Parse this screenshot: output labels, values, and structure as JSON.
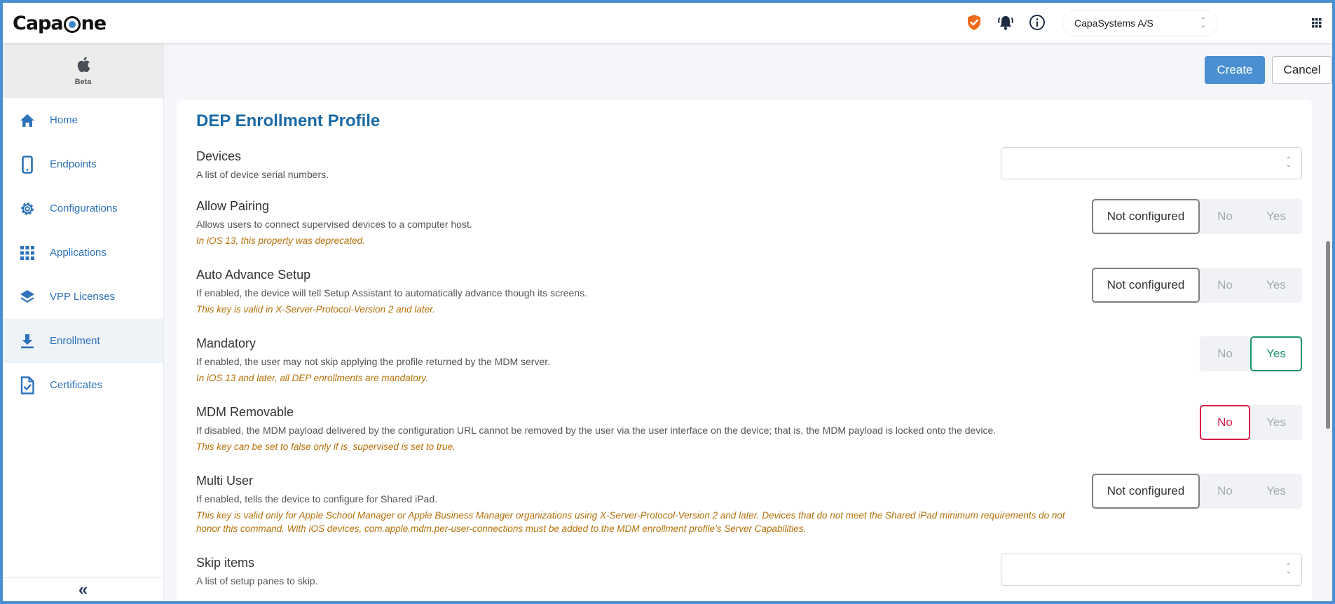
{
  "header": {
    "logo_text_left": "Capa",
    "logo_text_right": "ne",
    "org_selector": "CapaSystems A/S",
    "icons": [
      "shield-check-icon",
      "bell-icon",
      "info-icon",
      "apps-grid-icon"
    ],
    "colors": {
      "shield": "#f26a1b",
      "accent": "#4a8fd1"
    }
  },
  "sidebar": {
    "platform": {
      "icon": "apple-icon",
      "label": "Beta"
    },
    "items": [
      {
        "label": "Home",
        "icon": "home-icon",
        "active": false
      },
      {
        "label": "Endpoints",
        "icon": "phone-icon",
        "active": false
      },
      {
        "label": "Configurations",
        "icon": "gear-icon",
        "active": false
      },
      {
        "label": "Applications",
        "icon": "grid-icon",
        "active": false
      },
      {
        "label": "VPP Licenses",
        "icon": "layers-icon",
        "active": false
      },
      {
        "label": "Enrollment",
        "icon": "download-icon",
        "active": true
      },
      {
        "label": "Certificates",
        "icon": "certificate-icon",
        "active": false
      }
    ],
    "collapse_label": "«"
  },
  "toolbar": {
    "create_label": "Create",
    "cancel_label": "Cancel"
  },
  "form": {
    "title": "DEP Enrollment Profile",
    "fields": [
      {
        "label": "Devices",
        "description": "A list of device serial numbers.",
        "note": "",
        "control": "select",
        "value": ""
      },
      {
        "label": "Allow Pairing",
        "description": "Allows users to connect supervised devices to a computer host.",
        "note": "In iOS 13, this property was deprecated.",
        "control": "toggle3",
        "options": [
          "Not configured",
          "No",
          "Yes"
        ],
        "selected": "Not configured"
      },
      {
        "label": "Auto Advance Setup",
        "description": "If enabled, the device will tell Setup Assistant to automatically advance though its screens.",
        "note": "This key is valid in X-Server-Protocol-Version 2 and later.",
        "control": "toggle3",
        "options": [
          "Not configured",
          "No",
          "Yes"
        ],
        "selected": "Not configured"
      },
      {
        "label": "Mandatory",
        "description": "If enabled, the user may not skip applying the profile returned by the MDM server.",
        "note": "In iOS 13 and later, all DEP enrollments are mandatory.",
        "control": "toggle2",
        "options": [
          "No",
          "Yes"
        ],
        "selected": "Yes"
      },
      {
        "label": "MDM Removable",
        "description": "If disabled, the MDM payload delivered by the configuration URL cannot be removed by the user via the user interface on the device; that is, the MDM payload is locked onto the device.",
        "note": "This key can be set to false only if is_supervised is set to true.",
        "control": "toggle2",
        "options": [
          "No",
          "Yes"
        ],
        "selected": "No"
      },
      {
        "label": "Multi User",
        "description": "If enabled, tells the device to configure for Shared iPad.",
        "note": "This key is valid only for Apple School Manager or Apple Business Manager organizations using X-Server-Protocol-Version 2 and later. Devices that do not meet the Shared iPad minimum requirements do not honor this command. With iOS devices, com.apple.mdm.per-user-connections must be added to the MDM enrollment profile’s Server Capabilities.",
        "control": "toggle3",
        "options": [
          "Not configured",
          "No",
          "Yes"
        ],
        "selected": "Not configured"
      },
      {
        "label": "Skip items",
        "description": "A list of setup panes to skip.",
        "note": "",
        "control": "select",
        "value": ""
      }
    ]
  }
}
